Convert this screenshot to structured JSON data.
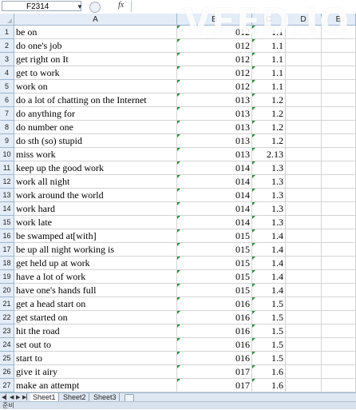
{
  "formula_bar": {
    "name_box": "F2314",
    "fx_label": "fx",
    "formula_value": ""
  },
  "columns": [
    "A",
    "B",
    "C",
    "D",
    "E"
  ],
  "rows": [
    {
      "num": "1",
      "a": "be on",
      "b": "012",
      "c": "1.1"
    },
    {
      "num": "2",
      "a": "do one's job",
      "b": "012",
      "c": "1.1"
    },
    {
      "num": "3",
      "a": "get right on It",
      "b": "012",
      "c": "1.1"
    },
    {
      "num": "4",
      "a": "get to work",
      "b": "012",
      "c": "1.1"
    },
    {
      "num": "5",
      "a": "work on",
      "b": "012",
      "c": "1.1"
    },
    {
      "num": "6",
      "a": "do a lot of chatting on the Internet",
      "b": "013",
      "c": "1.2"
    },
    {
      "num": "7",
      "a": "do anything for",
      "b": "013",
      "c": "1.2"
    },
    {
      "num": "8",
      "a": "do number one",
      "b": "013",
      "c": "1.2"
    },
    {
      "num": "9",
      "a": "do sth (so) stupid",
      "b": "013",
      "c": "1.2"
    },
    {
      "num": "10",
      "a": "miss work",
      "b": "013",
      "c": "2.13"
    },
    {
      "num": "11",
      "a": "keep up the good work",
      "b": "014",
      "c": "1.3"
    },
    {
      "num": "12",
      "a": "work all night",
      "b": "014",
      "c": "1.3"
    },
    {
      "num": "13",
      "a": "work around the world",
      "b": "014",
      "c": "1.3"
    },
    {
      "num": "14",
      "a": "work hard",
      "b": "014",
      "c": "1.3"
    },
    {
      "num": "15",
      "a": "work late",
      "b": "014",
      "c": "1.3"
    },
    {
      "num": "16",
      "a": "be swamped at[with]",
      "b": "015",
      "c": "1.4"
    },
    {
      "num": "17",
      "a": "be up all night working is",
      "b": "015",
      "c": "1.4"
    },
    {
      "num": "18",
      "a": "get held up at work",
      "b": "015",
      "c": "1.4"
    },
    {
      "num": "19",
      "a": "have a lot of work",
      "b": "015",
      "c": "1.4"
    },
    {
      "num": "20",
      "a": "have one's hands full",
      "b": "015",
      "c": "1.4"
    },
    {
      "num": "21",
      "a": "get a head start on",
      "b": "016",
      "c": "1.5"
    },
    {
      "num": "22",
      "a": "get started on",
      "b": "016",
      "c": "1.5"
    },
    {
      "num": "23",
      "a": "hit the road",
      "b": "016",
      "c": "1.5"
    },
    {
      "num": "24",
      "a": "set out to",
      "b": "016",
      "c": "1.5"
    },
    {
      "num": "25",
      "a": "start to",
      "b": "016",
      "c": "1.5"
    },
    {
      "num": "26",
      "a": "give it airy",
      "b": "017",
      "c": "1.6"
    },
    {
      "num": "27",
      "a": "make an attempt",
      "b": "017",
      "c": "1.6"
    }
  ],
  "sheet_tabs": [
    "Sheet1",
    "Sheet2",
    "Sheet3"
  ],
  "status_text": "준비",
  "watermark": "VEED.IO",
  "colors": {
    "header_bg": "#e4ecf7",
    "error_indicator": "#2e8b3e",
    "gridline": "#d4d4d4"
  }
}
